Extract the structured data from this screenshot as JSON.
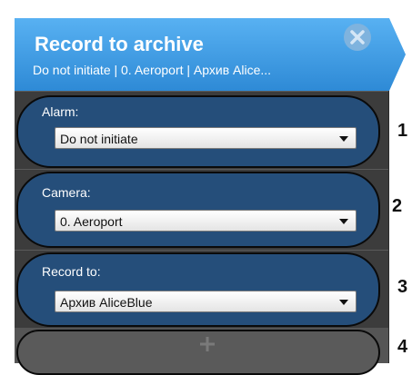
{
  "dialog": {
    "title": "Record to archive",
    "subtitle": "Do not initiate | 0. Aeroport | Архив Alice..."
  },
  "fields": [
    {
      "label": "Alarm:",
      "value": "Do not initiate",
      "number": "1"
    },
    {
      "label": "Camera:",
      "value": "0. Aeroport",
      "number": "2"
    },
    {
      "label": "Record to:",
      "value": "Архив AliceBlue",
      "number": "3"
    }
  ],
  "add_row": {
    "number": "4",
    "icon": "plus-icon"
  },
  "colors": {
    "header": "#3a9ae0",
    "field_bg": "#254e7a",
    "panel_bg": "#4a4a4a"
  },
  "icons": [
    "close-icon",
    "chevron-down-icon",
    "plus-icon"
  ]
}
